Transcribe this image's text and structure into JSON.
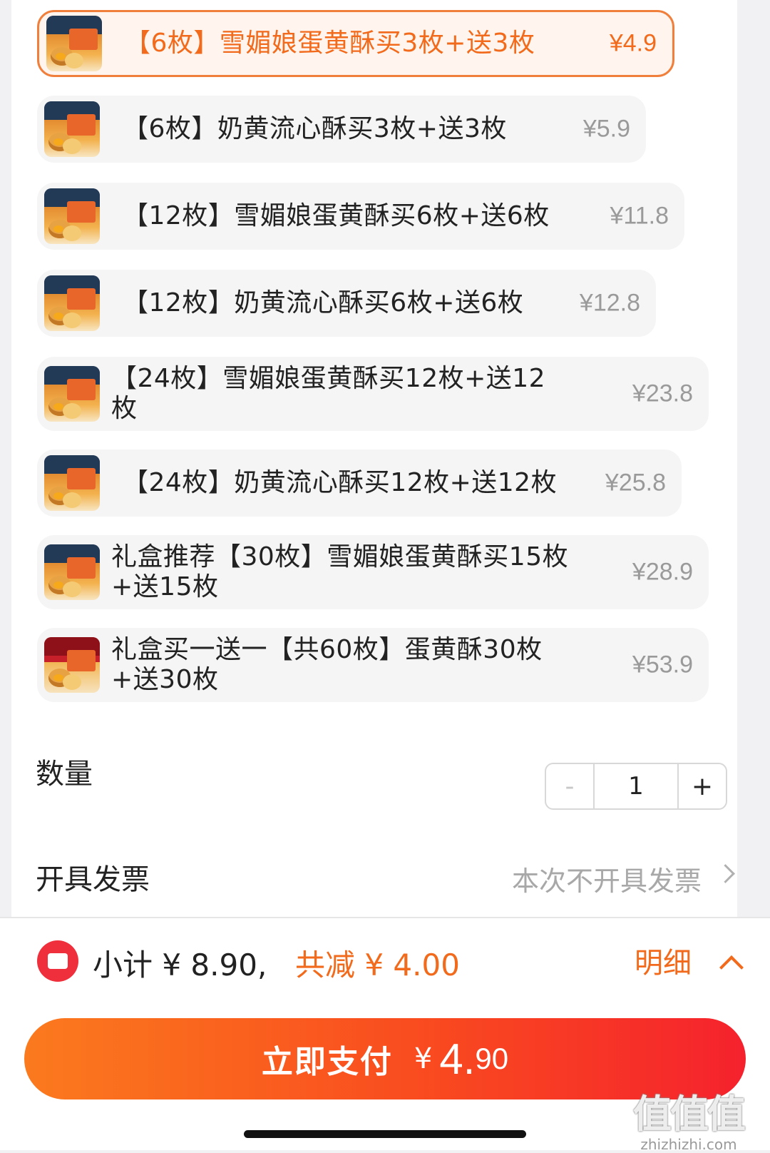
{
  "sku_options": [
    {
      "name": "【6枚】雪媚娘蛋黄酥买3枚+送3枚",
      "price": "¥4.9",
      "selected": true
    },
    {
      "name": "【6枚】奶黄流心酥买3枚+送3枚",
      "price": "¥5.9",
      "selected": false
    },
    {
      "name": "【12枚】雪媚娘蛋黄酥买6枚+送6枚",
      "price": "¥11.8",
      "selected": false
    },
    {
      "name": "【12枚】奶黄流心酥买6枚+送6枚",
      "price": "¥12.8",
      "selected": false
    },
    {
      "name": "【24枚】雪媚娘蛋黄酥买12枚+送12枚",
      "price": "¥23.8",
      "selected": false
    },
    {
      "name": "【24枚】奶黄流心酥买12枚+送12枚",
      "price": "¥25.8",
      "selected": false
    },
    {
      "name": "礼盒推荐【30枚】雪媚娘蛋黄酥买15枚+送15枚",
      "price": "¥28.9",
      "selected": false
    },
    {
      "name": "礼盒买一送一【共60枚】蛋黄酥30枚+送30枚",
      "price": "¥53.9",
      "selected": false
    }
  ],
  "quantity": {
    "label": "数量",
    "minus": "-",
    "value": "1",
    "plus": "+"
  },
  "invoice": {
    "label": "开具发票",
    "value": "本次不开具发票"
  },
  "footer": {
    "subtotal": "小计 ¥ 8.90,",
    "discount": "共减 ¥ 4.00",
    "detail": "明细",
    "pay_label": "立即支付",
    "pay_currency": "¥",
    "pay_int": "4.",
    "pay_dec": "90"
  },
  "watermark": {
    "main": "值值值",
    "url": "zhizhizhi.com"
  },
  "colors": {
    "accent": "#f26a1b",
    "pay_gradient_start": "#fb7a1e",
    "pay_gradient_end": "#f5222d",
    "coupon_red": "#ef2f3b"
  }
}
